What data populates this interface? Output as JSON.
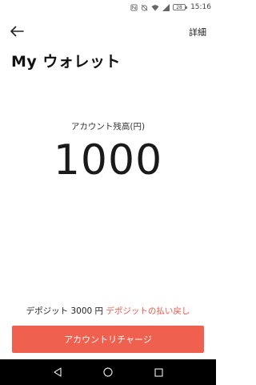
{
  "status_bar": {
    "battery": "28",
    "time": "15:16"
  },
  "header": {
    "details": "詳細",
    "title": "My ウォレット"
  },
  "balance": {
    "label": "アカウント残高(円)",
    "value": "1000"
  },
  "deposit": {
    "text": "デポジット 3000 円",
    "refund_link": "デポジットの払い戻し"
  },
  "recharge_button": "アカウントリチャージ",
  "colors": {
    "accent": "#f0604e",
    "link": "#ef5545"
  }
}
